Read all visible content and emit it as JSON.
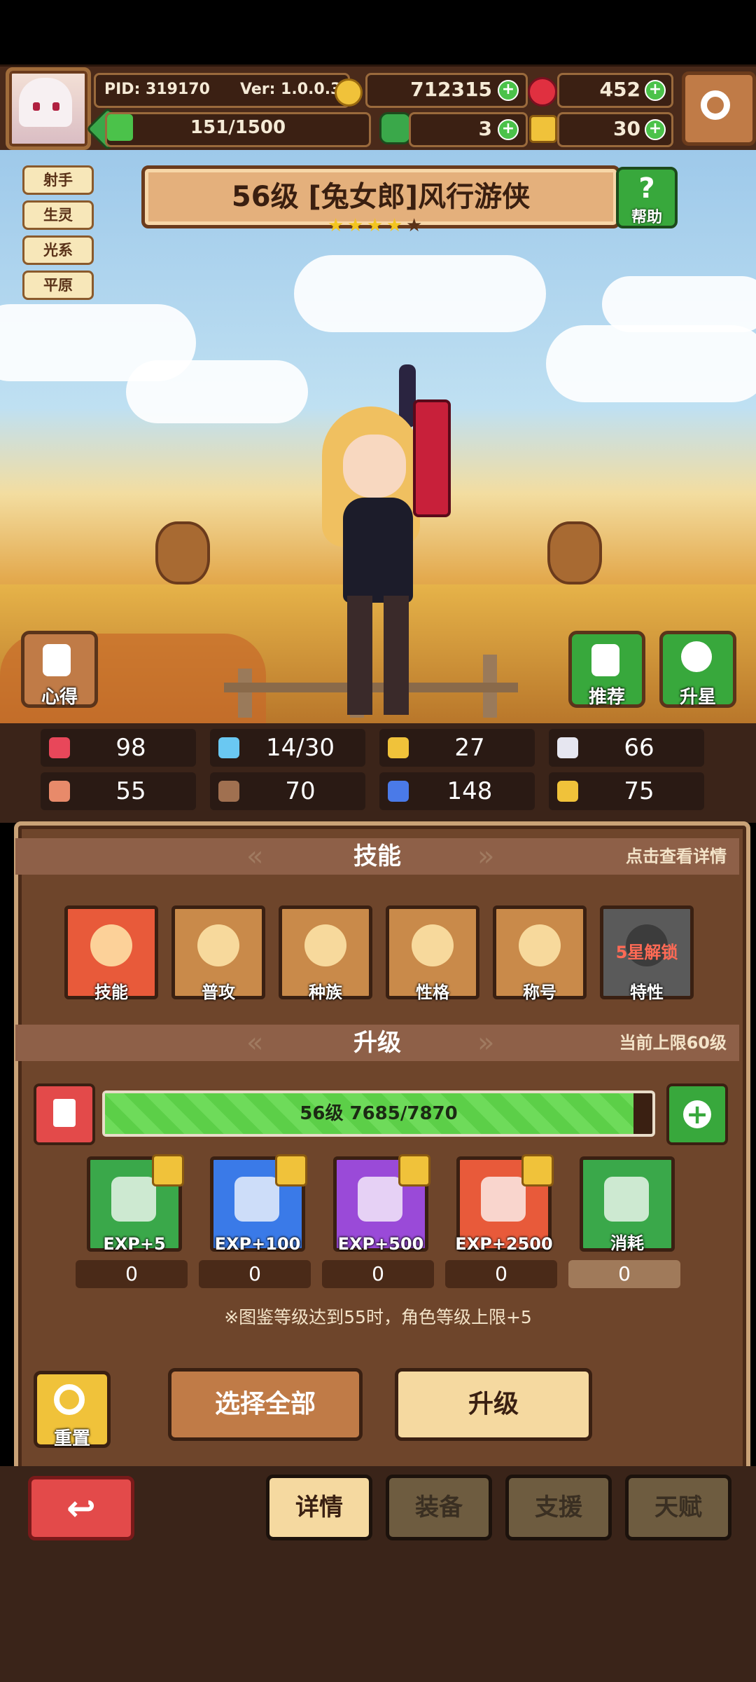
{
  "hud": {
    "pid": "PID: 319170",
    "version": "Ver: 1.0.0.3",
    "gold": "712315",
    "gems": "452",
    "stamina": "151/1500",
    "stamina_fraction": 0.1,
    "clover": "3",
    "key": "30",
    "icons": [
      "avatar",
      "gold-coin-icon",
      "red-gem-icon",
      "clover-icon",
      "key-icon",
      "settings-gear-icon"
    ]
  },
  "character": {
    "title": "56级 [兔女郎]风行游侠",
    "stars_filled": 4,
    "stars_total": 5,
    "tags": [
      "射手",
      "生灵",
      "光系",
      "平原"
    ],
    "help_label": "帮助",
    "insight_label": "心得",
    "recommend_label": "推荐",
    "upstar_label": "升星"
  },
  "stats": [
    {
      "icon": "heart-icon",
      "value": "98",
      "color": "#e8475a"
    },
    {
      "icon": "water-drop-icon",
      "value": "14/30",
      "color": "#6ac8f2"
    },
    {
      "icon": "shield-icon",
      "value": "27",
      "color": "#f0c23a"
    },
    {
      "icon": "wing-icon",
      "value": "66",
      "color": "#e6e6f0"
    },
    {
      "icon": "fist-icon",
      "value": "55",
      "color": "#e88a6a"
    },
    {
      "icon": "book-icon",
      "value": "70",
      "color": "#a07050"
    },
    {
      "icon": "boot-icon",
      "value": "148",
      "color": "#4a7ae8"
    },
    {
      "icon": "horseshoe-icon",
      "value": "75",
      "color": "#f0c23a"
    }
  ],
  "skills_section": {
    "title": "技能",
    "hint": "点击查看详情",
    "items": [
      {
        "label": "技能",
        "color": "#e85a3a"
      },
      {
        "label": "普攻",
        "color": "#c98a4a"
      },
      {
        "label": "种族",
        "color": "#c98a4a"
      },
      {
        "label": "性格",
        "color": "#c98a4a"
      },
      {
        "label": "称号",
        "color": "#c98a4a"
      },
      {
        "label": "特性",
        "color": "#5a5a5a",
        "lock": "5星解锁"
      }
    ]
  },
  "upgrade_section": {
    "title": "升级",
    "hint": "当前上限60级",
    "exp_text": "56级  7685/7870",
    "exp_fraction": 0.976,
    "items": [
      {
        "label": "EXP+5",
        "count": "0",
        "color": "#3aa84a"
      },
      {
        "label": "EXP+100",
        "count": "0",
        "color": "#3a7ae8"
      },
      {
        "label": "EXP+500",
        "count": "0",
        "color": "#9a4ad8"
      },
      {
        "label": "EXP+2500",
        "count": "0",
        "color": "#e85a3a"
      },
      {
        "label": "消耗",
        "count": "0",
        "color": "#3aa84a"
      }
    ],
    "note": "※图鉴等级达到55时，角色等级上限+5"
  },
  "actions": {
    "reset": "重置",
    "select_all": "选择全部",
    "upgrade": "升级"
  },
  "nav": {
    "back_icon": "back-arrow-icon",
    "tabs": [
      "详情",
      "装备",
      "支援",
      "天赋"
    ],
    "active_tab": 0
  }
}
